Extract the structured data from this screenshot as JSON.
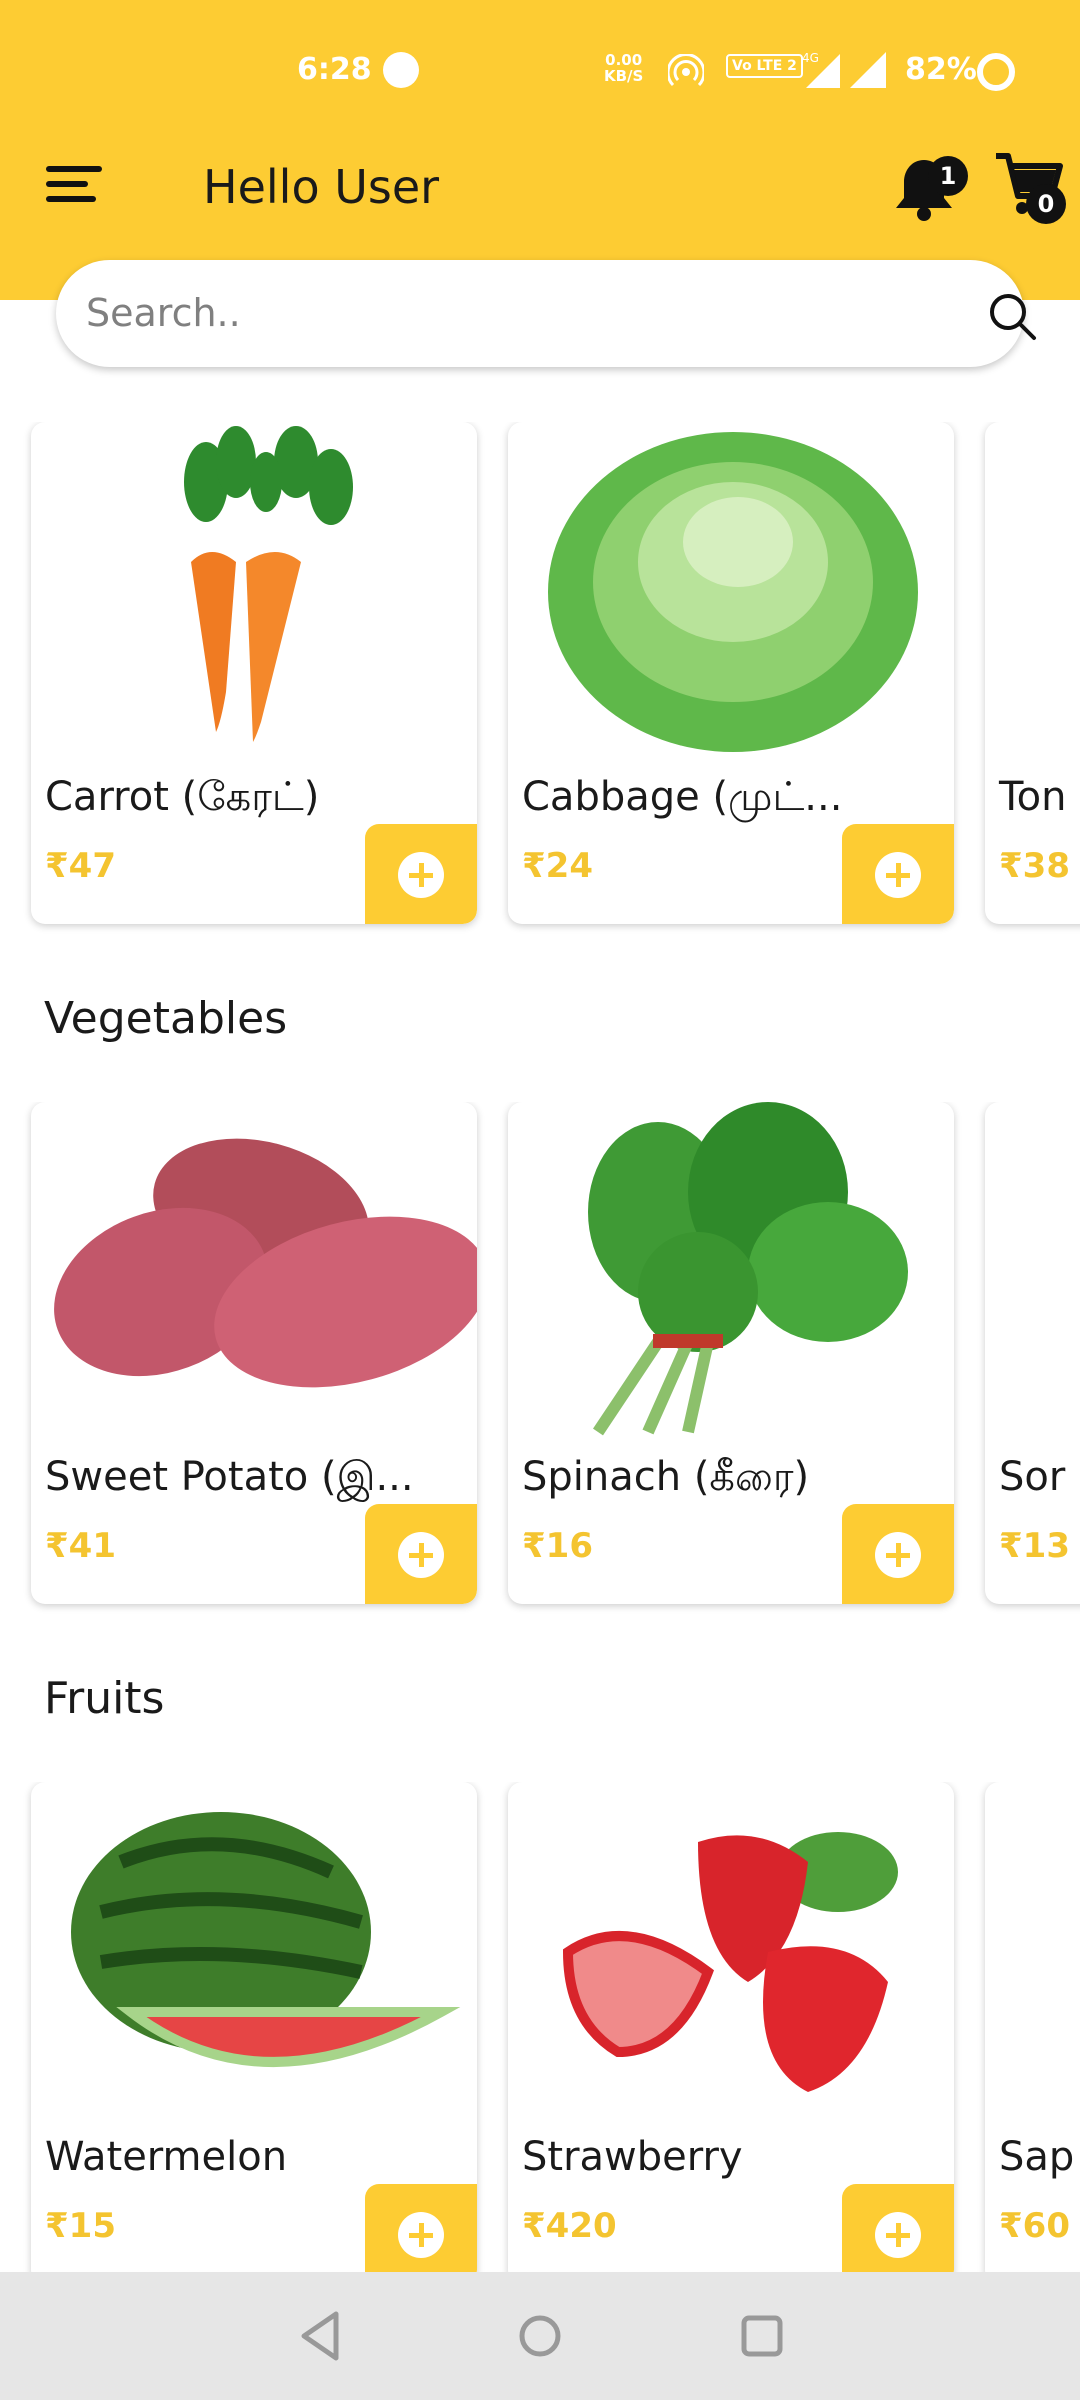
{
  "status_bar": {
    "time": "6:28",
    "net_speed_value": "0.00",
    "net_speed_unit": "KB/S",
    "volte": "Vo LTE 2",
    "network": "4G",
    "battery": "82%"
  },
  "header": {
    "greeting": "Hello User",
    "notification_count": "1",
    "cart_count": "0",
    "background_color": "#fdcc33"
  },
  "search": {
    "placeholder": "Search..",
    "value": ""
  },
  "featured": {
    "items": [
      {
        "name": "Carrot (கேரட்)",
        "price": "₹47",
        "icon": "carrot-image"
      },
      {
        "name": "Cabbage (முட்...",
        "price": "₹24",
        "icon": "cabbage-image"
      },
      {
        "name": "Ton",
        "price": "₹38",
        "icon": "tomato-image"
      }
    ]
  },
  "vegetables": {
    "title": "Vegetables",
    "items": [
      {
        "name": "Sweet Potato (இ...",
        "price": "₹41",
        "icon": "sweet-potato-image"
      },
      {
        "name": "Spinach (கீரை)",
        "price": "₹16",
        "icon": "spinach-image"
      },
      {
        "name": "Sor",
        "price": "₹13",
        "icon": "sorrel-image"
      }
    ]
  },
  "fruits": {
    "title": "Fruits",
    "items": [
      {
        "name": "Watermelon",
        "price": "₹15",
        "icon": "watermelon-image"
      },
      {
        "name": "Strawberry",
        "price": "₹420",
        "icon": "strawberry-image"
      },
      {
        "name": "Sap",
        "price": "₹60",
        "icon": "sapota-image"
      }
    ]
  },
  "accent_color": "#fdcc33",
  "price_color": "#f4c430"
}
